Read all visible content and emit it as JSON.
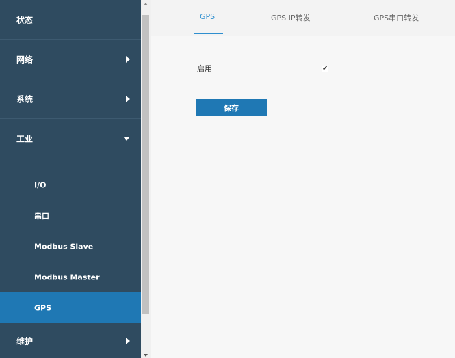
{
  "sidebar": {
    "items": [
      {
        "label": "状态",
        "icon": "none"
      },
      {
        "label": "网络",
        "icon": "chevron-right-icon"
      },
      {
        "label": "系统",
        "icon": "chevron-right-icon"
      },
      {
        "label": "工业",
        "icon": "chevron-down-icon"
      },
      {
        "label": "维护",
        "icon": "chevron-right-icon"
      }
    ],
    "submenu": [
      {
        "label": "I/O"
      },
      {
        "label": "串口"
      },
      {
        "label": "Modbus Slave"
      },
      {
        "label": "Modbus Master"
      },
      {
        "label": "GPS",
        "active": true
      }
    ]
  },
  "tabs": [
    {
      "label": "GPS",
      "active": true
    },
    {
      "label": "GPS IP转发",
      "active": false
    },
    {
      "label": "GPS串口转发",
      "active": false
    }
  ],
  "form": {
    "enable_label": "启用",
    "enable_checked": true,
    "checkbox_glyph": "✔",
    "save_label": "保存"
  },
  "colors": {
    "sidebar_bg": "#2f4b60",
    "active_item": "#1f78b4",
    "accent": "#2f8fcf"
  }
}
